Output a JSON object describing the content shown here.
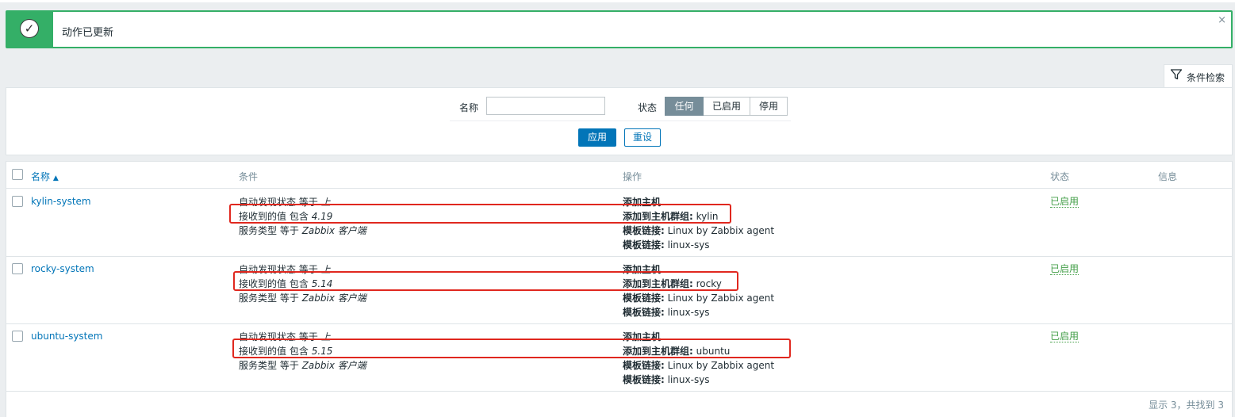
{
  "message": {
    "text": "动作已更新",
    "close": "×",
    "icon": "check-icon"
  },
  "filter": {
    "tab_label": "条件检索",
    "name_label": "名称",
    "name_value": "",
    "status_label": "状态",
    "status_options": [
      "任何",
      "已启用",
      "停用"
    ],
    "status_selected": "任何",
    "apply_label": "应用",
    "reset_label": "重设"
  },
  "table": {
    "headers": {
      "name": "名称",
      "conditions": "条件",
      "operations": "操作",
      "status": "状态",
      "info": "信息"
    },
    "rows": [
      {
        "name": "kylin-system",
        "conditions": [
          {
            "field": "自动发现状态",
            "op": "等于",
            "value": "上"
          },
          {
            "field": "接收到的值",
            "op": "包含",
            "value": "4.19"
          },
          {
            "field": "服务类型",
            "op": "等于",
            "value": "Zabbix 客户端"
          }
        ],
        "operations": [
          {
            "label": "添加主机",
            "value": ""
          },
          {
            "label": "添加到主机群组:",
            "value": "kylin"
          },
          {
            "label": "模板链接:",
            "value": "Linux by Zabbix agent"
          },
          {
            "label": "模板链接:",
            "value": "linux-sys"
          }
        ],
        "status": "已启用"
      },
      {
        "name": "rocky-system",
        "conditions": [
          {
            "field": "自动发现状态",
            "op": "等于",
            "value": "上"
          },
          {
            "field": "接收到的值",
            "op": "包含",
            "value": "5.14"
          },
          {
            "field": "服务类型",
            "op": "等于",
            "value": "Zabbix 客户端"
          }
        ],
        "operations": [
          {
            "label": "添加主机",
            "value": ""
          },
          {
            "label": "添加到主机群组:",
            "value": "rocky"
          },
          {
            "label": "模板链接:",
            "value": "Linux by Zabbix agent"
          },
          {
            "label": "模板链接:",
            "value": "linux-sys"
          }
        ],
        "status": "已启用"
      },
      {
        "name": "ubuntu-system",
        "conditions": [
          {
            "field": "自动发现状态",
            "op": "等于",
            "value": "上"
          },
          {
            "field": "接收到的值",
            "op": "包含",
            "value": "5.15"
          },
          {
            "field": "服务类型",
            "op": "等于",
            "value": "Zabbix 客户端"
          }
        ],
        "operations": [
          {
            "label": "添加主机",
            "value": ""
          },
          {
            "label": "添加到主机群组:",
            "value": "ubuntu"
          },
          {
            "label": "模板链接:",
            "value": "Linux by Zabbix agent"
          },
          {
            "label": "模板链接:",
            "value": "linux-sys"
          }
        ],
        "status": "已启用"
      }
    ],
    "footer": "显示 3，共找到 3"
  },
  "colors": {
    "success": "#34af67",
    "link": "#0275b8",
    "enabled": "#429e47",
    "annotation": "#e0281f"
  }
}
